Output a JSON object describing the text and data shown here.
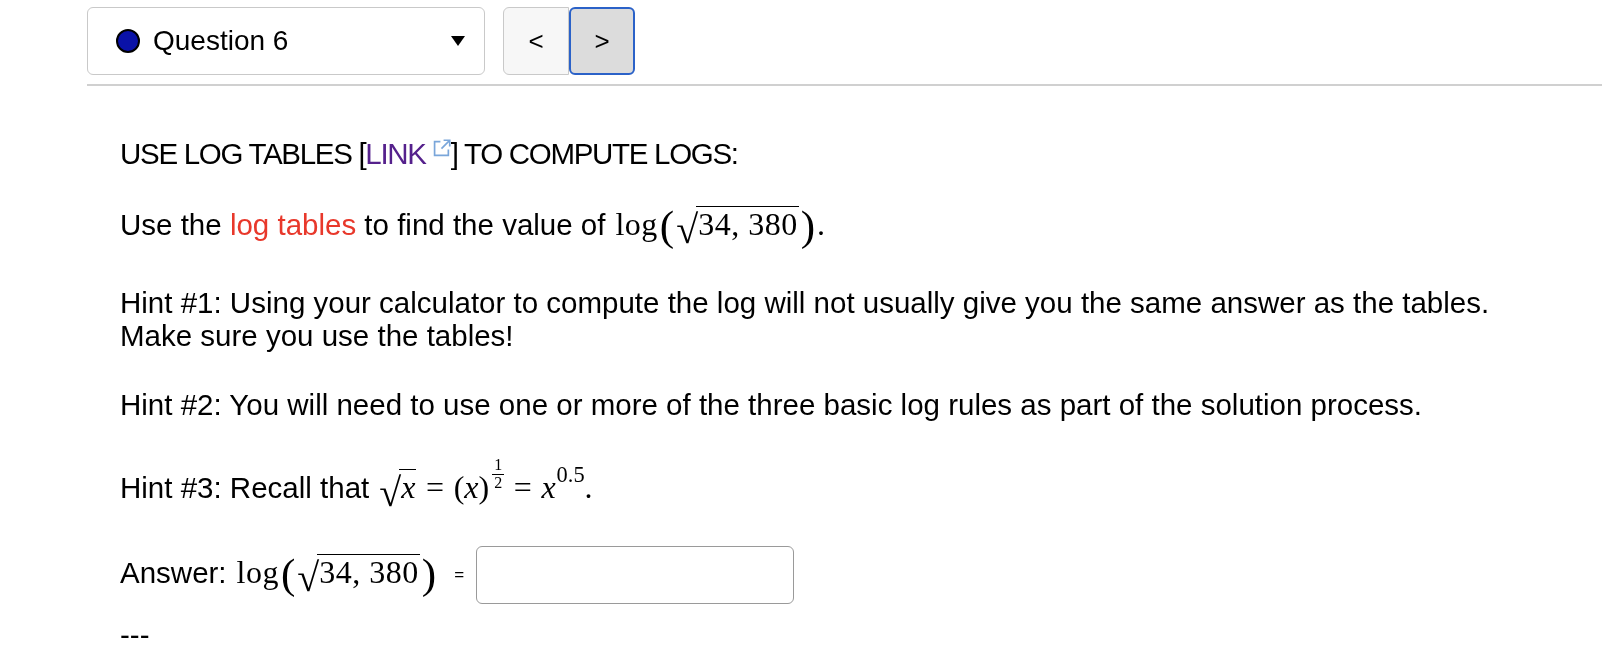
{
  "question_select": {
    "label": "Question 6",
    "color": "#0a12a8"
  },
  "nav_buttons": [
    {
      "label": "<",
      "focused": false
    },
    {
      "label": ">",
      "focused": true
    }
  ],
  "heading": {
    "before": "USE LOG TABLES [",
    "link": "LINK",
    "after": "] TO COMPUTE LOGS:"
  },
  "problem": {
    "before": "Use the ",
    "link": "log tables",
    "after": " to find the value of",
    "math": [
      {
        "kind": "fn",
        "text": "log"
      },
      {
        "kind": "open",
        "text": "(",
        "large": true
      },
      {
        "kind": "sqrt",
        "symbol": "√",
        "body": [
          {
            "kind": "num",
            "text": "34, 380"
          }
        ]
      },
      {
        "kind": "close",
        "text": ")",
        "large": true
      },
      {
        "kind": "punct",
        "text": "."
      }
    ]
  },
  "hints": [
    {
      "lines": [
        "Hint #1: Using your calculator to compute the log will not usually give you the same answer as the tables.",
        "Make sure you use the tables!"
      ]
    },
    {
      "lines": [
        "Hint #2: You will need to use one or more of the three basic log rules as part of the solution process."
      ]
    },
    {
      "lines": [
        "Hint #3: Recall that"
      ],
      "math": [
        {
          "kind": "sqrt",
          "symbol": "√",
          "body": [
            {
              "kind": "var",
              "text": "x"
            }
          ]
        },
        {
          "kind": "op",
          "text": "="
        },
        {
          "kind": "open",
          "text": "(",
          "large": false
        },
        {
          "kind": "var",
          "text": "x"
        },
        {
          "kind": "close",
          "text": ")",
          "large": false
        },
        {
          "kind": "frac-sup",
          "numerator": "1",
          "denominator": "2"
        },
        {
          "kind": "op",
          "text": "="
        },
        {
          "kind": "var",
          "text": "x"
        },
        {
          "kind": "sup",
          "text": "0.5"
        },
        {
          "kind": "punct",
          "text": "."
        }
      ]
    }
  ],
  "answer": {
    "label": "Answer:",
    "math": [
      {
        "kind": "fn",
        "text": "log"
      },
      {
        "kind": "open",
        "text": "(",
        "large": true
      },
      {
        "kind": "sqrt",
        "symbol": "√",
        "body": [
          {
            "kind": "num",
            "text": "34, 380"
          }
        ]
      },
      {
        "kind": "close",
        "text": ")",
        "large": true
      }
    ],
    "equals": "="
  },
  "footer_text": "---"
}
